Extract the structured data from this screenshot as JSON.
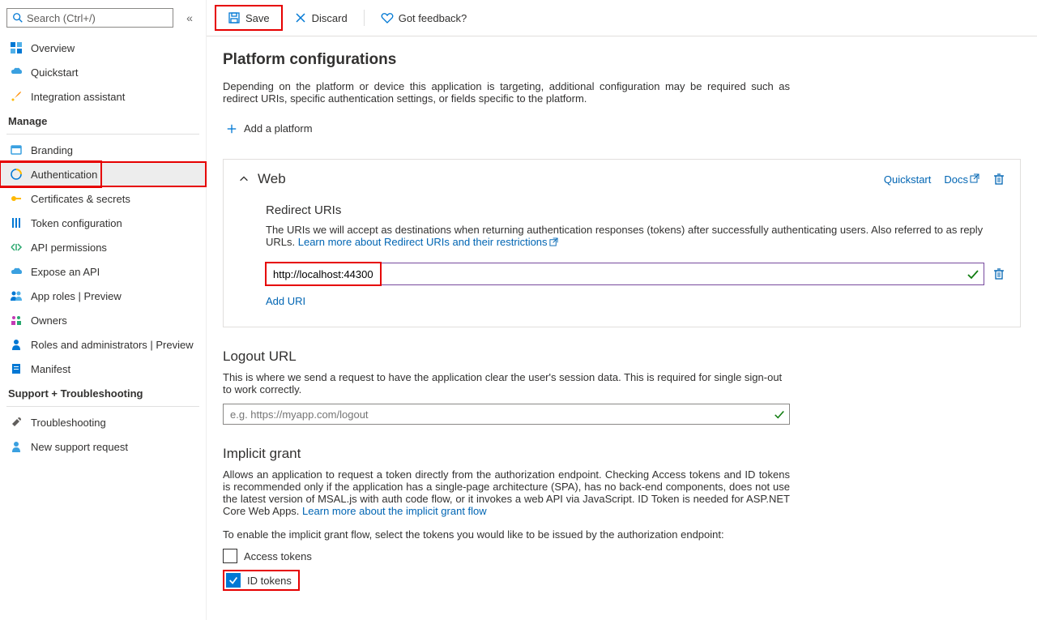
{
  "sidebar": {
    "search_placeholder": "Search (Ctrl+/)",
    "items_primary": [
      {
        "label": "Overview"
      },
      {
        "label": "Quickstart"
      },
      {
        "label": "Integration assistant"
      }
    ],
    "manage_header": "Manage",
    "items_manage": [
      {
        "label": "Branding"
      },
      {
        "label": "Authentication"
      },
      {
        "label": "Certificates & secrets"
      },
      {
        "label": "Token configuration"
      },
      {
        "label": "API permissions"
      },
      {
        "label": "Expose an API"
      },
      {
        "label": "App roles | Preview"
      },
      {
        "label": "Owners"
      },
      {
        "label": "Roles and administrators | Preview"
      },
      {
        "label": "Manifest"
      }
    ],
    "support_header": "Support + Troubleshooting",
    "items_support": [
      {
        "label": "Troubleshooting"
      },
      {
        "label": "New support request"
      }
    ]
  },
  "toolbar": {
    "save": "Save",
    "discard": "Discard",
    "feedback": "Got feedback?"
  },
  "page": {
    "title": "Platform configurations",
    "desc": "Depending on the platform or device this application is targeting, additional configuration may be required such as redirect URIs, specific authentication settings, or fields specific to the platform.",
    "add_platform": "Add a platform"
  },
  "web": {
    "title": "Web",
    "quickstart": "Quickstart",
    "docs": "Docs",
    "redirect_title": "Redirect URIs",
    "redirect_desc": "The URIs we will accept as destinations when returning authentication responses (tokens) after successfully authenticating users. Also referred to as reply URLs. ",
    "redirect_link": "Learn more about Redirect URIs and their restrictions",
    "uri_value": "http://localhost:44300",
    "add_uri": "Add URI"
  },
  "logout": {
    "title": "Logout URL",
    "desc": "This is where we send a request to have the application clear the user's session data. This is required for single sign-out to work correctly.",
    "placeholder": "e.g. https://myapp.com/logout"
  },
  "implicit": {
    "title": "Implicit grant",
    "desc1": "Allows an application to request a token directly from the authorization endpoint. Checking Access tokens and ID tokens is recommended only if the application has a single-page architecture (SPA), has no back-end components, does not use the latest version of MSAL.js with auth code flow, or it invokes a web API via JavaScript. ID Token is needed for ASP.NET Core Web Apps. ",
    "link": "Learn more about the implicit grant flow",
    "desc2": "To enable the implicit grant flow, select the tokens you would like to be issued by the authorization endpoint:",
    "access_tokens": "Access tokens",
    "id_tokens": "ID tokens"
  }
}
